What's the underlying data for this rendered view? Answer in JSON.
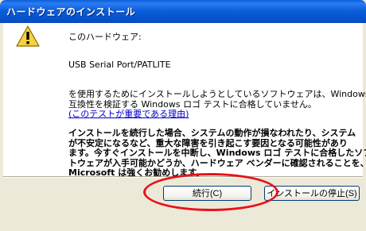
{
  "window": {
    "title": "ハードウェアのインストール"
  },
  "content": {
    "intro": "このハードウェア:",
    "device_name": "USB Serial Port/PATLITE",
    "paragraph1_lines": [
      "を使用するためにインストールしようとしているソフトウェアは、Windows XP との",
      "互換性を検証する Windows ロゴ テストに合格していません。"
    ],
    "link_text": "(このテストが重要である理由)",
    "paragraph2_lines": [
      "インストールを続行した場合、システムの動作が損なわれたり、システム",
      "が不安定になるなど、重大な障害を引き起こす要因となる可能性があり",
      "ます。今すぐインストールを中断し、Windows ロゴ テストに合格したソフ",
      "トウェアが入手可能かどうか、ハードウェア ベンダーに確認されることを、",
      "Microsoft は強くお勧めします。"
    ]
  },
  "buttons": {
    "continue_label": "続行(C)",
    "stop_label": "インストールの停止(S)"
  },
  "icons": {
    "warning": "warning-triangle-icon"
  },
  "colors": {
    "titlebar": "#0a5fd8",
    "dialog_bg": "#ece9d8",
    "link": "#0000cc",
    "highlight_ellipse": "#e8101a"
  }
}
